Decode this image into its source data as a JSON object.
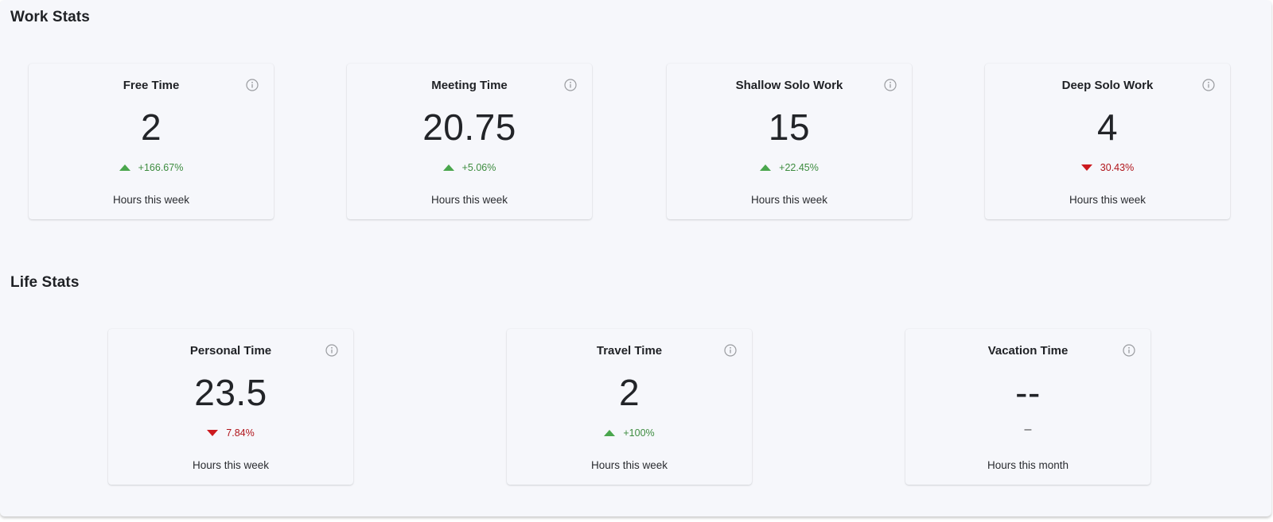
{
  "colors": {
    "background": "#f6f7fb",
    "positive": "#3d8c3f",
    "negative": "#b0141a",
    "info_icon": "#9a9ca0"
  },
  "work_stats": {
    "title": "Work Stats",
    "cards": [
      {
        "title": "Free Time",
        "value": "2",
        "change": "+166.67%",
        "direction": "up",
        "caption": "Hours this week",
        "icon": "info-icon"
      },
      {
        "title": "Meeting Time",
        "value": "20.75",
        "change": "+5.06%",
        "direction": "up",
        "caption": "Hours this week",
        "icon": "info-icon"
      },
      {
        "title": "Shallow Solo Work",
        "value": "15",
        "change": "+22.45%",
        "direction": "up",
        "caption": "Hours this week",
        "icon": "info-icon"
      },
      {
        "title": "Deep Solo Work",
        "value": "4",
        "change": "30.43%",
        "direction": "down",
        "caption": "Hours this week",
        "icon": "info-icon"
      }
    ]
  },
  "life_stats": {
    "title": "Life Stats",
    "cards": [
      {
        "title": "Personal Time",
        "value": "23.5",
        "change": "7.84%",
        "direction": "down",
        "caption": "Hours this week",
        "icon": "info-icon"
      },
      {
        "title": "Travel Time",
        "value": "2",
        "change": "+100%",
        "direction": "up",
        "caption": "Hours this week",
        "icon": "info-icon"
      },
      {
        "title": "Vacation Time",
        "value": "--",
        "change": "–",
        "direction": "none",
        "caption": "Hours this month",
        "icon": "info-icon"
      }
    ]
  }
}
